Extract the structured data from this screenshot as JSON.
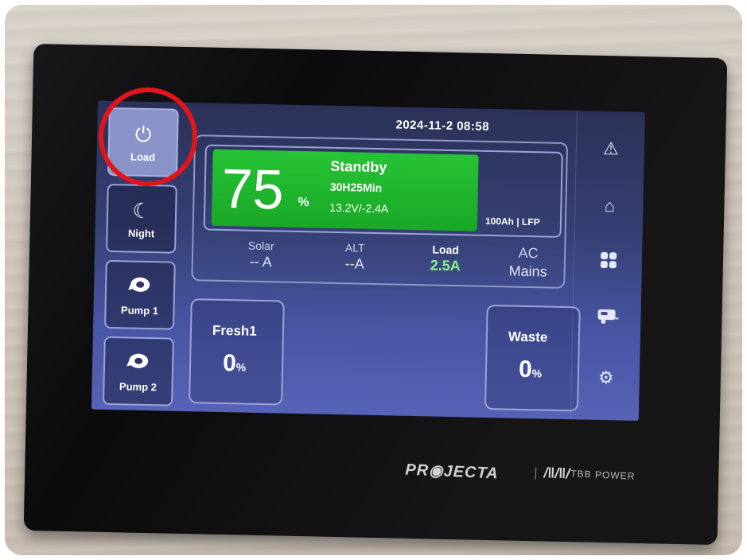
{
  "header": {
    "datetime": "2024-11-2  08:58"
  },
  "left_buttons": [
    {
      "label": "Load",
      "icon": "power-icon",
      "active": true
    },
    {
      "label": "Night",
      "icon": "moon-icon",
      "active": false
    },
    {
      "label": "Pump 1",
      "icon": "pump-icon",
      "active": false
    },
    {
      "label": "Pump 2",
      "icon": "pump-icon",
      "active": false
    }
  ],
  "battery": {
    "percent": "75",
    "percent_unit": "%",
    "state": "Standby",
    "runtime": "30H25Min",
    "voltage_current": "13.2V/-2.4A",
    "capacity": "100Ah | LFP",
    "level": 0.75,
    "color": "#1db42a"
  },
  "flows": [
    {
      "label": "Solar",
      "value": "-- A"
    },
    {
      "label": "ALT",
      "value": "--A"
    },
    {
      "label": "Load",
      "value": "2.5A"
    },
    {
      "label": "AC",
      "value": "Mains"
    }
  ],
  "tanks": [
    {
      "label": "Fresh1",
      "value": "0",
      "unit": "%"
    },
    {
      "label": "Waste",
      "value": "0",
      "unit": "%"
    }
  ],
  "nav_icons": [
    "warning-icon",
    "home-icon",
    "grid-icon",
    "caravan-icon",
    "gear-icon"
  ],
  "branding": {
    "left": "PR◉JECTA",
    "separator": "|",
    "bars": "/‖/‖/",
    "right": "TBB POWER"
  },
  "accent": {
    "highlight_ring": "#e3141c",
    "screen": "#3d4789"
  }
}
